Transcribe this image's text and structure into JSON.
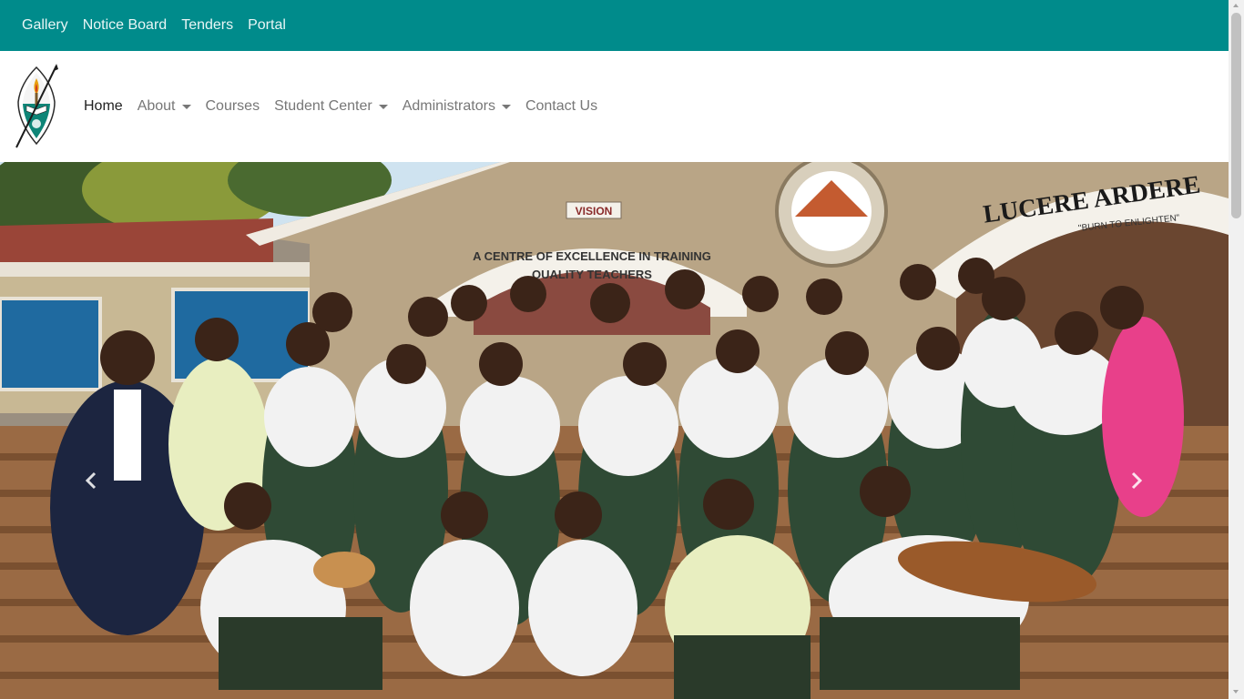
{
  "topbar": {
    "links": [
      "Gallery",
      "Notice Board",
      "Tenders",
      "Portal"
    ]
  },
  "brand": {
    "logo_text": "LUCERE ARDERE",
    "logo_icon": "school-crest-icon"
  },
  "navbar": {
    "items": [
      {
        "label": "Home",
        "active": true,
        "dropdown": false
      },
      {
        "label": "About",
        "active": false,
        "dropdown": true
      },
      {
        "label": "Courses",
        "active": false,
        "dropdown": false
      },
      {
        "label": "Student Center",
        "active": false,
        "dropdown": true
      },
      {
        "label": "Administrators",
        "active": false,
        "dropdown": true
      },
      {
        "label": "Contact Us",
        "active": false,
        "dropdown": false
      }
    ]
  },
  "hero": {
    "sign_vision": "VISION",
    "arch_text_1": "A CENTRE OF EXCELLENCE IN TRAINING",
    "arch_text_2": "QUALITY TEACHERS",
    "motto": "LUCERE ARDERE",
    "motto_sub": "\"BURN TO ENLIGHTEN\"",
    "prev_icon": "chevron-left-icon",
    "next_icon": "chevron-right-icon"
  },
  "colors": {
    "topbar": "#008b8b",
    "nav_text": "#777777",
    "nav_active": "#222222"
  }
}
